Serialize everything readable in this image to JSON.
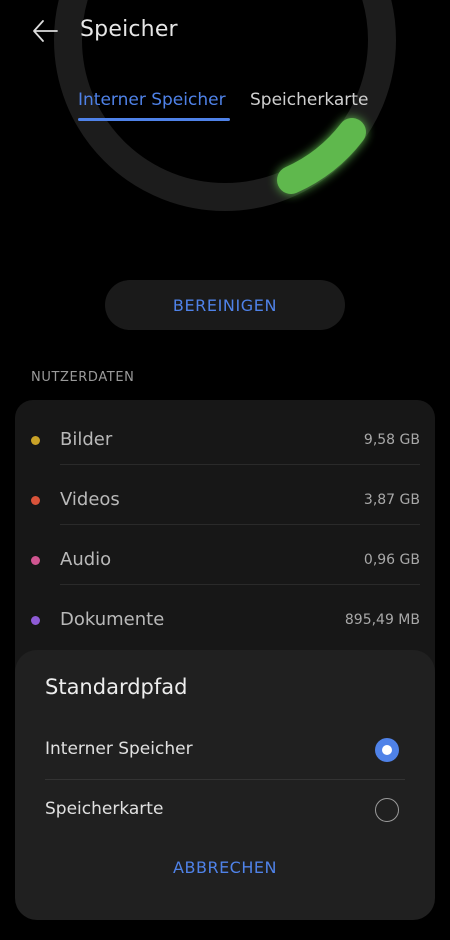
{
  "header": {
    "title": "Speicher",
    "back_icon": "arrow-left-icon"
  },
  "tabs": [
    {
      "label": "Interner Speicher",
      "active": true
    },
    {
      "label": "Speicherkarte",
      "active": false
    }
  ],
  "storage_ring": {
    "used_color": "#5fb84e",
    "track_color": "#1c1c1c"
  },
  "clean_button": {
    "label": "BEREINIGEN"
  },
  "user_data": {
    "section_label": "NUTZERDATEN",
    "items": [
      {
        "label": "Bilder",
        "value": "9,58 GB",
        "color": "#c9a227"
      },
      {
        "label": "Videos",
        "value": "3,87 GB",
        "color": "#d9533a"
      },
      {
        "label": "Audio",
        "value": "0,96 GB",
        "color": "#d05590"
      },
      {
        "label": "Dokumente",
        "value": "895,49 MB",
        "color": "#8e5bd6"
      }
    ]
  },
  "dialog": {
    "title": "Standardpfad",
    "options": [
      {
        "label": "Interner Speicher",
        "selected": true
      },
      {
        "label": "Speicherkarte",
        "selected": false
      }
    ],
    "cancel_label": "ABBRECHEN"
  },
  "colors": {
    "accent": "#4f82e8",
    "background": "#000000",
    "card": "#171717",
    "dialog": "#202020"
  }
}
